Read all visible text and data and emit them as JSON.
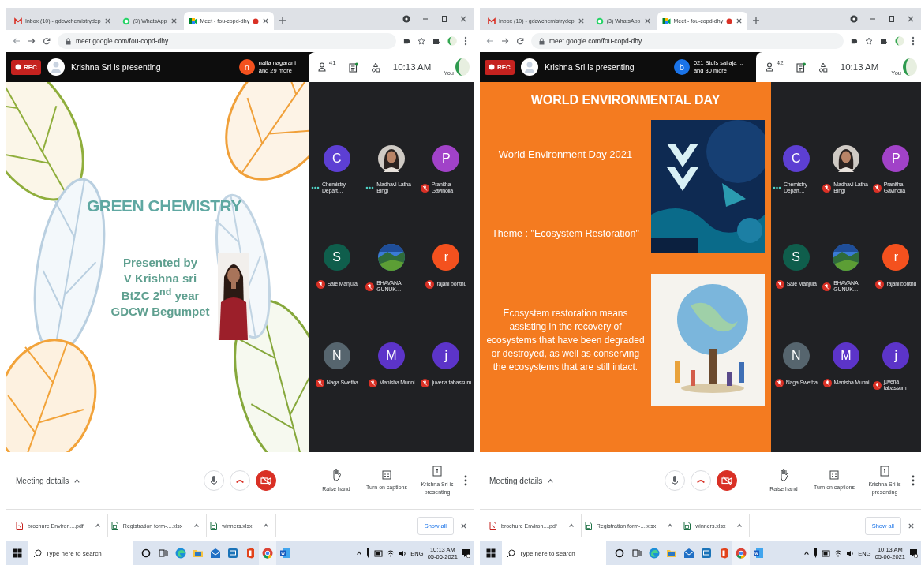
{
  "windows": [
    {
      "tabs": [
        {
          "title": "Inbox (10) - gdcwchemistrydep",
          "kind": "gmail",
          "selected": false,
          "recording": false
        },
        {
          "title": "(3) WhatsApp",
          "kind": "whatsapp",
          "selected": false,
          "recording": false
        },
        {
          "title": "Meet - fou-copd-dhy",
          "kind": "meet",
          "selected": true,
          "recording": true
        }
      ],
      "url": "meet.google.com/fou-copd-dhy",
      "header": {
        "rec_label": "REC",
        "presenter_status": "Krishna Sri is presenting",
        "chip": {
          "initial": "n",
          "color": "#f4511e",
          "line_1": "nalla nagarani",
          "line_2": "and 29 more"
        },
        "people_count": "41",
        "time": "10:13 AM",
        "you_label": "You"
      },
      "slide": {
        "kind": "title",
        "title": "GREEN CHEMISTRY",
        "lines": [
          "Presented by",
          "V Krishna sri",
          "BtZC 2$^{nd}$ year",
          "GDCW Begumpet"
        ]
      },
      "participants": [
        {
          "name": "Chemistry Depart…",
          "kind": "letter",
          "initial": "C",
          "color": "#5d3fd3",
          "muted": false
        },
        {
          "name": "Madhavi Latha Bingi",
          "muted": false
        },
        {
          "name": "Pranitha Gavinolla",
          "kind": "letter",
          "initial": "P",
          "color": "#a142c8",
          "muted": true
        },
        {
          "name": "Sale Manjula",
          "kind": "letter",
          "initial": "S",
          "color": "#0f5e4c",
          "muted": true
        },
        {
          "name": "BHAVANA GUNUK…",
          "kind": "landscape",
          "muted": true
        },
        {
          "name": "rajani bonthu",
          "kind": "letter",
          "initial": "r",
          "color": "#f4511e",
          "muted": true
        },
        {
          "name": "Naga Swetha",
          "kind": "letter",
          "initial": "N",
          "color": "#56656e",
          "muted": true
        },
        {
          "name": "Manisha Munni",
          "kind": "letter",
          "initial": "M",
          "color": "#5c34c9",
          "muted": true
        },
        {
          "name": "juveria tabassum",
          "kind": "letter",
          "initial": "j",
          "color": "#5c34c9",
          "muted": true
        }
      ],
      "controls": {
        "meeting_details": "Meeting details",
        "mic_muted": false,
        "camera_off": true,
        "actions": [
          {
            "label": "Raise hand",
            "kind": "hand"
          },
          {
            "label": "Turn on captions",
            "kind": "captions"
          },
          {
            "label": "Krishna Sri is presenting",
            "kind": "present"
          }
        ]
      },
      "downloads": {
        "items": [
          {
            "name": "brochure Environ....pdf",
            "kind": "pdf"
          },
          {
            "name": "Registration form-....xlsx",
            "kind": "sheet"
          },
          {
            "name": "winners.xlsx",
            "kind": "sheet"
          }
        ],
        "show_all": "Show all"
      },
      "taskbar": {
        "search_placeholder": "Type here to search",
        "apps": [
          {
            "kind": "cortana",
            "selected": false
          },
          {
            "kind": "taskview",
            "selected": false
          },
          {
            "kind": "edge",
            "selected": false
          },
          {
            "kind": "folder",
            "selected": false
          },
          {
            "kind": "mail",
            "selected": false
          },
          {
            "kind": "remote",
            "selected": false
          },
          {
            "kind": "office",
            "selected": false
          },
          {
            "kind": "chrome",
            "selected": true
          },
          {
            "kind": "word",
            "selected": false
          }
        ],
        "language": "ENG",
        "time": "10:13 AM",
        "date": "05-06-2021"
      }
    },
    {
      "tabs": [
        {
          "title": "Inbox (10) - gdcwchemistrydep",
          "kind": "gmail",
          "selected": false,
          "recording": false
        },
        {
          "title": "(3) WhatsApp",
          "kind": "whatsapp",
          "selected": false,
          "recording": false
        },
        {
          "title": "Meet - fou-copd-dhy",
          "kind": "meet",
          "selected": true,
          "recording": true
        }
      ],
      "url": "meet.google.com/fou-copd-dhy",
      "header": {
        "rec_label": "REC",
        "presenter_status": "Krishna Sri is presenting",
        "chip": {
          "initial": "b",
          "color": "#1a73e8",
          "line_1": "021 Btcfs sailaja ...",
          "line_2": "and 30 more"
        },
        "people_count": "42",
        "time": "10:13 AM",
        "you_label": "You"
      },
      "slide": {
        "kind": "info",
        "title": "WORLD ENVIRONMENTAL DAY",
        "heading": "World Environment Day 2021",
        "theme": "Theme : \"Ecosystem Restoration\"",
        "paragraph": "Ecosystem restoration means assisting in the recovery of ecosystems that have been degraded or destroyed, as well as conserving the ecosystems that are still intact."
      },
      "participants": [
        {
          "name": "Chemistry Depart…",
          "kind": "letter",
          "initial": "C",
          "color": "#5d3fd3",
          "muted": false
        },
        {
          "name": "Madhavi Latha Bingi",
          "muted": true
        },
        {
          "name": "Pranitha Gavinolla",
          "kind": "letter",
          "initial": "P",
          "color": "#a142c8",
          "muted": true
        },
        {
          "name": "Sale Manjula",
          "kind": "letter",
          "initial": "S",
          "color": "#0f5e4c",
          "muted": true
        },
        {
          "name": "BHAVANA GUNUK…",
          "kind": "landscape",
          "muted": true
        },
        {
          "name": "rajani bonthu",
          "kind": "letter",
          "initial": "r",
          "color": "#f4511e",
          "muted": true
        },
        {
          "name": "Naga Swetha",
          "kind": "letter",
          "initial": "N",
          "color": "#56656e",
          "muted": true
        },
        {
          "name": "Manisha Munni",
          "kind": "letter",
          "initial": "M",
          "color": "#5c34c9",
          "muted": true
        },
        {
          "name": "juveria tabassum",
          "kind": "letter",
          "initial": "j",
          "color": "#5c34c9",
          "muted": true
        }
      ],
      "controls": {
        "meeting_details": "Meeting details",
        "mic_muted": false,
        "camera_off": true,
        "actions": [
          {
            "label": "Raise hand",
            "kind": "hand"
          },
          {
            "label": "Turn on captions",
            "kind": "captions"
          },
          {
            "label": "Krishna Sri is presenting",
            "kind": "present"
          }
        ]
      },
      "downloads": {
        "items": [
          {
            "name": "brochure Environ....pdf",
            "kind": "pdf"
          },
          {
            "name": "Registration form-....xlsx",
            "kind": "sheet"
          },
          {
            "name": "winners.xlsx",
            "kind": "sheet"
          }
        ],
        "show_all": "Show all"
      },
      "taskbar": {
        "search_placeholder": "Type here to search",
        "apps": [
          {
            "kind": "cortana",
            "selected": false
          },
          {
            "kind": "taskview",
            "selected": false
          },
          {
            "kind": "edge",
            "selected": false
          },
          {
            "kind": "folder",
            "selected": false
          },
          {
            "kind": "mail",
            "selected": false
          },
          {
            "kind": "remote",
            "selected": false
          },
          {
            "kind": "office",
            "selected": false
          },
          {
            "kind": "chrome",
            "selected": true
          },
          {
            "kind": "word",
            "selected": false
          }
        ],
        "language": "ENG",
        "time": "10:13 AM",
        "date": "05-06-2021"
      }
    }
  ]
}
